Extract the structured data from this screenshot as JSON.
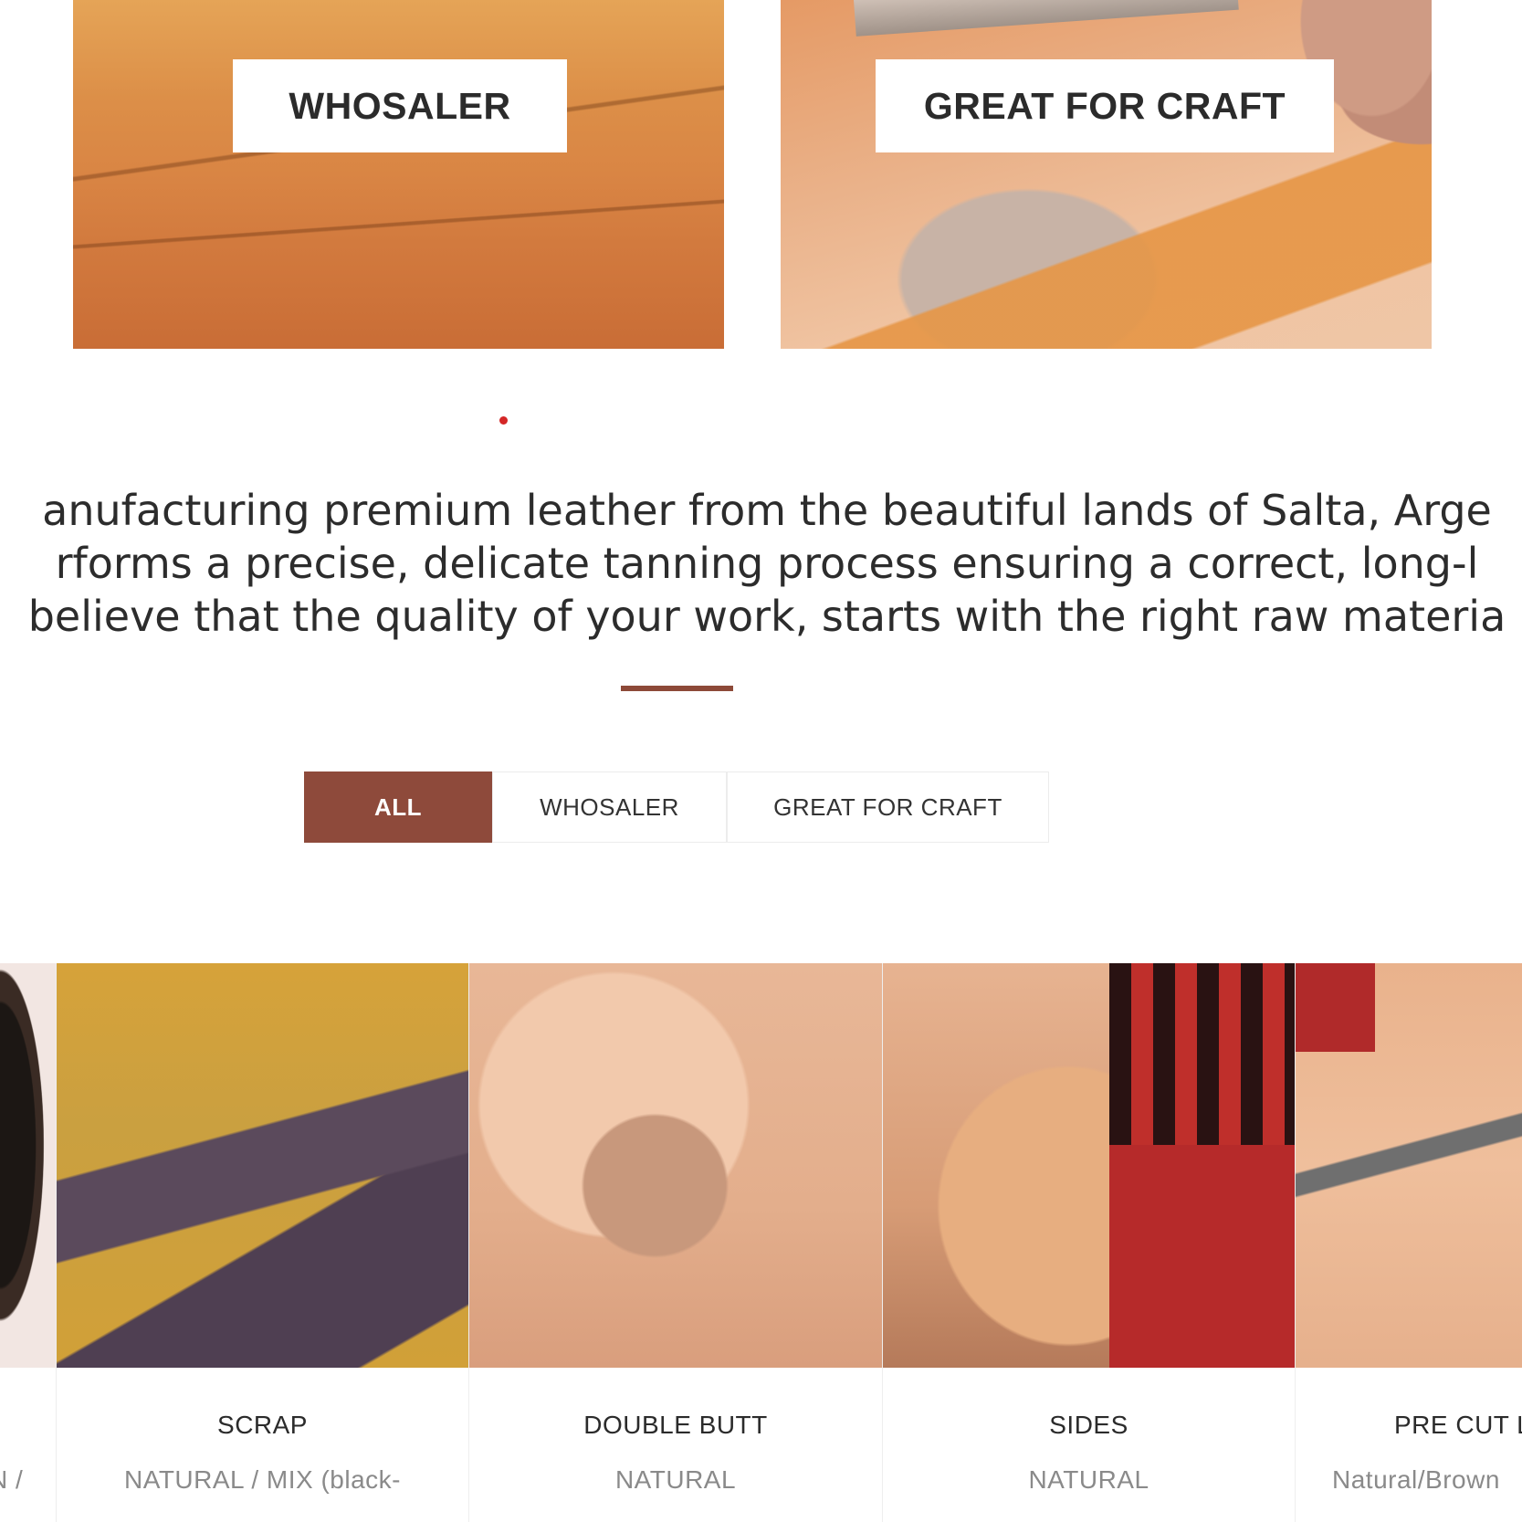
{
  "banners": [
    {
      "label": "WHOSALER"
    },
    {
      "label": "GREAT FOR CRAFT"
    }
  ],
  "intro": {
    "lines": [
      "anufacturing premium leather from the beautiful lands of Salta, Arge",
      "rforms a precise, delicate tanning process ensuring a correct, long-l",
      "believe that the quality of your work, starts with the right raw materia"
    ]
  },
  "filters": [
    {
      "label": "ALL",
      "active": true
    },
    {
      "label": "WHOSALER",
      "active": false
    },
    {
      "label": "GREAT FOR CRAFT",
      "active": false
    }
  ],
  "products": [
    {
      "name": "",
      "subtitle": "N /"
    },
    {
      "name": "SCRAP",
      "subtitle": "NATURAL / MIX (black-"
    },
    {
      "name": "DOUBLE BUTT",
      "subtitle": "NATURAL"
    },
    {
      "name": "SIDES",
      "subtitle": "NATURAL"
    },
    {
      "name": "PRE CUT LI",
      "subtitle": "Natural/Brown"
    }
  ],
  "colors": {
    "accent": "#8e4a3b",
    "dot": "#d42626"
  }
}
